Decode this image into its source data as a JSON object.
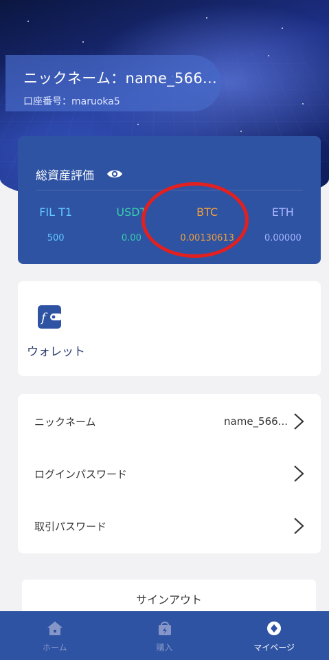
{
  "profile": {
    "nickname_display": "ニックネーム：name_566...",
    "account_display": "口座番号：maruoka5"
  },
  "assets": {
    "title": "総資産評価",
    "visibility_icon": "eye-icon",
    "coins": [
      {
        "symbol": "FIL T1",
        "balance": "500",
        "color": "#62c8ff"
      },
      {
        "symbol": "USDT",
        "balance": "0.00",
        "color": "#38cfae"
      },
      {
        "symbol": "BTC",
        "balance": "0.00130613",
        "color": "#f0a03c"
      },
      {
        "symbol": "ETH",
        "balance": "0.00000",
        "color": "#a8b6ff"
      }
    ],
    "annotation_color": "#e32020"
  },
  "wallet": {
    "label": "ウォレット",
    "icon": "wallet-icon"
  },
  "settings": {
    "items": [
      {
        "label": "ニックネーム",
        "value": "name_566..."
      },
      {
        "label": "ログインパスワード",
        "value": ""
      },
      {
        "label": "取引パスワード",
        "value": ""
      }
    ]
  },
  "signout_label": "サインアウト",
  "tabbar": {
    "items": [
      {
        "label": "ホーム",
        "icon": "home-icon",
        "active": false
      },
      {
        "label": "購入",
        "icon": "purchase-bag-icon",
        "active": false
      },
      {
        "label": "マイページ",
        "icon": "mypage-icon",
        "active": true
      }
    ]
  },
  "colors": {
    "primary": "#2e53a3",
    "background": "#f2f2f4"
  }
}
